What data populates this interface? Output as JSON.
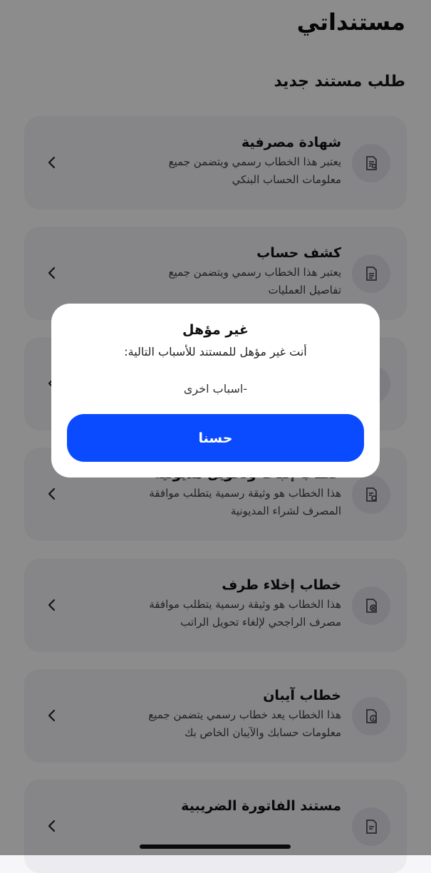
{
  "header": {
    "title": "مستنداتي"
  },
  "section": {
    "title": "طلب مستند جديد"
  },
  "cards": [
    {
      "title": "شهادة مصرفية",
      "desc_line1": "يعتبر هذا الخطاب رسمي ويتضمن جميع",
      "desc_line2": "معلومات الحساب البنكي",
      "icon": "certificate-icon"
    },
    {
      "title": "كشف حساب",
      "desc_line1": "يعتبر هذا الخطاب رسمي ويتضمن جميع",
      "desc_line2": "تفاصيل العمليات",
      "icon": "document-icon"
    },
    {
      "title": "",
      "desc_line1": "",
      "desc_line2": "",
      "icon": "document-icon"
    },
    {
      "title": "خطاب إثبات وتحويل مديونية",
      "desc_line1": "هذا الخطاب هو وثيقة رسمية يتطلب موافقة",
      "desc_line2": "المصرف لشراء المديونية",
      "icon": "debt-transfer-icon"
    },
    {
      "title": "خطاب إخلاء طرف",
      "desc_line1": "هذا الخطاب هو وثيقة رسمية يتطلب موافقة",
      "desc_line2": "مصرف الراجحي لإلغاء تحويل الراتب",
      "icon": "clearance-icon"
    },
    {
      "title": "خطاب آيبان",
      "desc_line1": "هذا الخطاب يعد خطاب رسمي يتضمن جميع",
      "desc_line2": "معلومات حسابك والآيبان الخاص بك",
      "icon": "iban-info-icon"
    },
    {
      "title": "مستند الفاتورة الضريبية",
      "desc_line1": "",
      "desc_line2": "",
      "icon": "tax-invoice-icon"
    }
  ],
  "dialog": {
    "title": "غير مؤهل",
    "message": "أنت غير مؤهل للمستند للأسباب التالية:",
    "reason": "-اسباب اخرى",
    "ok_label": "حسنا"
  },
  "colors": {
    "accent": "#0a4bff",
    "card_bg": "#ebebf0",
    "page_bg": "#f6f6f8"
  }
}
